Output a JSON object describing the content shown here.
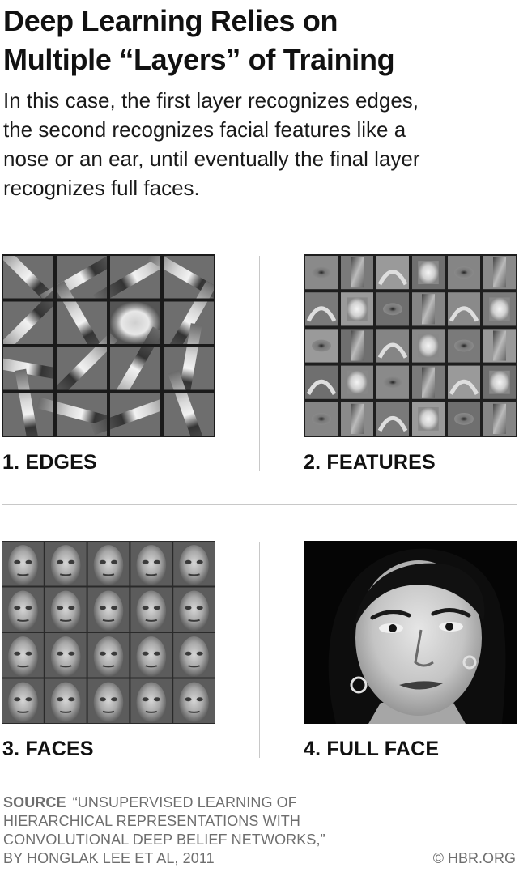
{
  "header": {
    "title_line_1": "Deep Learning Relies on",
    "title_line_2": "Multiple “Layers” of Training",
    "subtitle_line_1": "In this case, the first layer recognizes edges,",
    "subtitle_line_2": "the second recognizes facial features like a",
    "subtitle_line_3": "nose or an ear, until eventually the final layer",
    "subtitle_line_4": "recognizes full faces."
  },
  "panels": [
    {
      "label": "1. EDGES",
      "image": "edge-filters-grid"
    },
    {
      "label": "2. FEATURES",
      "image": "facial-feature-filters-grid"
    },
    {
      "label": "3. FACES",
      "image": "face-filters-grid"
    },
    {
      "label": "4. FULL FACE",
      "image": "portrait-photo"
    }
  ],
  "footer": {
    "source_key": "SOURCE",
    "source_line_1": "“UNSUPERVISED LEARNING OF",
    "source_line_2": "HIERARCHICAL REPRESENTATIONS WITH",
    "source_line_3": "CONVOLUTIONAL DEEP BELIEF NETWORKS,”",
    "source_line_4": "BY HONGLAK LEE ET AL, 2011",
    "credit": "© HBR.ORG"
  }
}
